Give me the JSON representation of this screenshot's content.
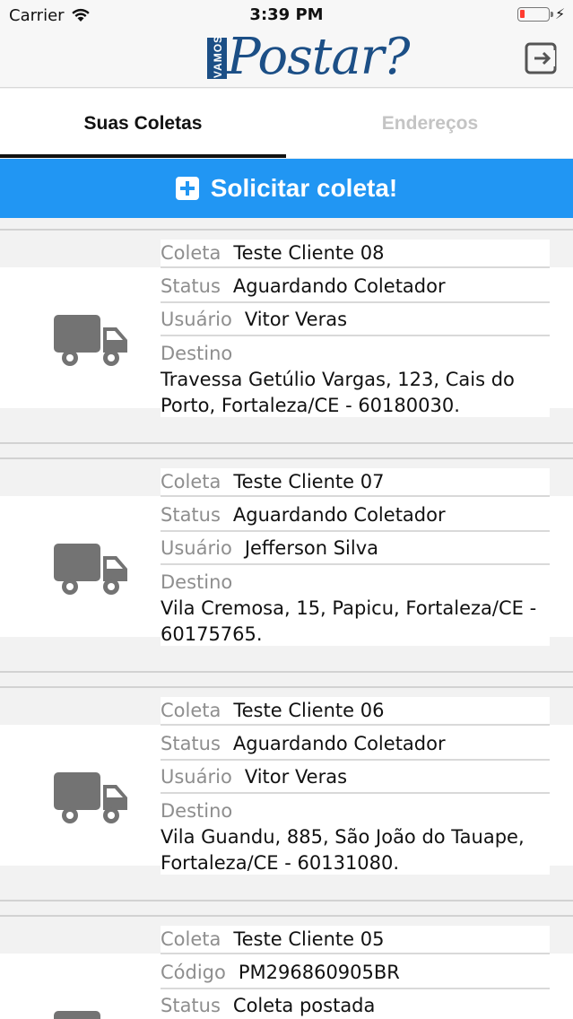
{
  "status_bar": {
    "carrier": "Carrier",
    "time": "3:39 PM"
  },
  "header": {
    "logo_small": "VAMOS",
    "logo_main": "Postar?",
    "exit_icon": "logout-icon"
  },
  "tabs": [
    {
      "label": "Suas Coletas",
      "active": true
    },
    {
      "label": "Endereços",
      "active": false
    }
  ],
  "action": {
    "label": "Solicitar coleta!",
    "icon": "plus-square-icon"
  },
  "labels": {
    "coleta": "Coleta",
    "status": "Status",
    "usuario": "Usuário",
    "destino": "Destino",
    "codigo": "Código"
  },
  "pickups": [
    {
      "coleta": "Teste Cliente 08",
      "status": "Aguardando Coletador",
      "usuario": "Vitor Veras",
      "destino_line1": "Travessa Getúlio Vargas, 123, Cais do",
      "destino_line2": "Porto, Fortaleza/CE - 60180030."
    },
    {
      "coleta": "Teste Cliente 07",
      "status": "Aguardando Coletador",
      "usuario": "Jefferson Silva",
      "destino_line1": "Vila Cremosa, 15, Papicu, Fortaleza/CE -",
      "destino_line2": "60175765."
    },
    {
      "coleta": "Teste Cliente 06",
      "status": "Aguardando Coletador",
      "usuario": "Vitor Veras",
      "destino_line1": "Vila Guandu, 885, São João do Tauape,",
      "destino_line2": "Fortaleza/CE - 60131080."
    },
    {
      "coleta": "Teste Cliente 05",
      "codigo": "PM296860905BR",
      "status": "Coleta postada"
    }
  ],
  "colors": {
    "accent": "#2196f3",
    "logo": "#1c4f86",
    "truck": "#737373"
  }
}
